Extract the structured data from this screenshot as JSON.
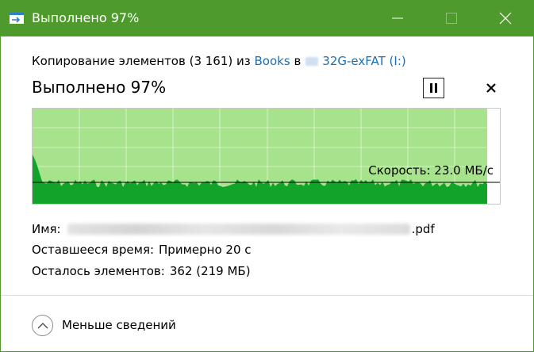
{
  "window": {
    "title": "Выполнено 97%",
    "accent_color": "#4f9a2c"
  },
  "copy": {
    "prefix": "Копирование элементов (3 161) из",
    "source": "Books",
    "middle": "в",
    "destination": "32G-exFAT (I:)"
  },
  "status": {
    "headline": "Выполнено 97%",
    "pause_icon": "pause-icon",
    "stop_icon": "close-icon"
  },
  "graph": {
    "speed_label": "Скорость: 23.0 МБ/с",
    "progress_fraction": 0.97,
    "fill_color": "#a6e38c",
    "speed_color": "#12a32a"
  },
  "details": {
    "name_label": "Имя:",
    "name_suffix": ".pdf",
    "time_label": "Оставшееся время:",
    "time_value": "Примерно 20 с",
    "items_label": "Осталось элементов:",
    "items_value": "362 (219 МБ)"
  },
  "footer": {
    "toggle_label": "Меньше сведений"
  }
}
